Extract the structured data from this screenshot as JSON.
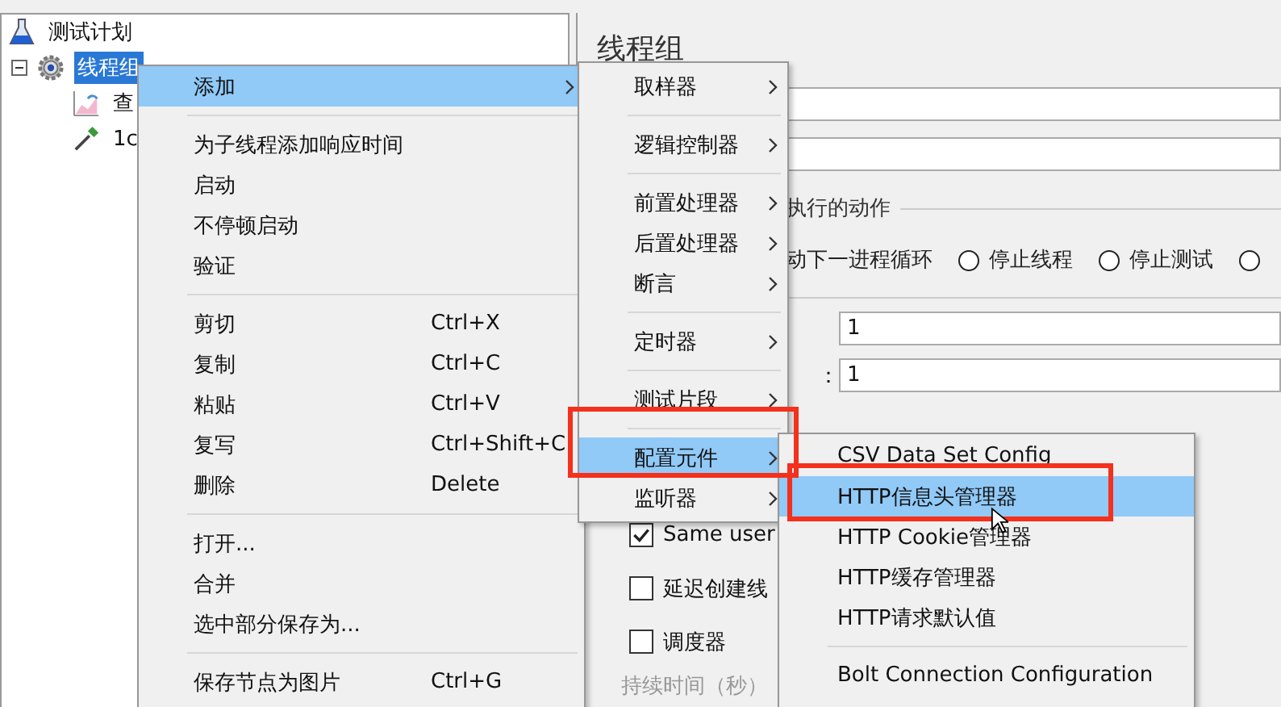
{
  "tree": [
    {
      "label": "测试计划",
      "selected": false,
      "children": [
        {
          "label": "线程组",
          "selected": true,
          "expanded": true,
          "children": [
            {
              "label": "查",
              "selected": false
            },
            {
              "label": "1c",
              "selected": false
            }
          ]
        }
      ]
    }
  ],
  "panel": {
    "title": "线程组",
    "action_group": {
      "legend": "执行的动作",
      "options": [
        {
          "kind": "text",
          "label": "动下一进程循环"
        },
        {
          "kind": "radio",
          "label": "停止线程",
          "selected": false
        },
        {
          "kind": "radio",
          "label": "停止测试",
          "selected": false
        },
        {
          "kind": "radio",
          "selected": false
        }
      ]
    },
    "counts": [
      {
        "value": "1"
      },
      {
        "label": "：",
        "value": "1"
      }
    ],
    "checkboxes": [
      {
        "label": "Same user",
        "checked": true
      },
      {
        "label": "延迟创建线",
        "checked": false
      },
      {
        "label": "调度器",
        "checked": false
      }
    ],
    "duration_label": "持续时间（秒）"
  },
  "context_menu": [
    {
      "kind": "item",
      "label": "添加",
      "submenu": true,
      "selected": true
    },
    {
      "kind": "separator"
    },
    {
      "kind": "item",
      "label": "为子线程添加响应时间",
      "submenu": false,
      "selected": false
    },
    {
      "kind": "item",
      "label": "启动",
      "submenu": false,
      "selected": false
    },
    {
      "kind": "item",
      "label": "不停顿启动",
      "submenu": false,
      "selected": false
    },
    {
      "kind": "item",
      "label": "验证",
      "submenu": false,
      "selected": false
    },
    {
      "kind": "separator"
    },
    {
      "kind": "item",
      "label": "剪切",
      "shortcut": "Ctrl+X",
      "submenu": false,
      "selected": false
    },
    {
      "kind": "item",
      "label": "复制",
      "shortcut": "Ctrl+C",
      "submenu": false,
      "selected": false
    },
    {
      "kind": "item",
      "label": "粘贴",
      "shortcut": "Ctrl+V",
      "submenu": false,
      "selected": false
    },
    {
      "kind": "item",
      "label": "复写",
      "shortcut": "Ctrl+Shift+C",
      "submenu": false,
      "selected": false
    },
    {
      "kind": "item",
      "label": "删除",
      "shortcut": "Delete",
      "submenu": false,
      "selected": false
    },
    {
      "kind": "separator"
    },
    {
      "kind": "item",
      "label": "打开...",
      "submenu": false,
      "selected": false
    },
    {
      "kind": "item",
      "label": "合并",
      "submenu": false,
      "selected": false
    },
    {
      "kind": "item",
      "label": "选中部分保存为...",
      "submenu": false,
      "selected": false
    },
    {
      "kind": "separator"
    },
    {
      "kind": "item",
      "label": "保存节点为图片",
      "shortcut": "Ctrl+G",
      "submenu": false,
      "selected": false
    }
  ],
  "add_submenu": [
    {
      "kind": "item",
      "label": "取样器",
      "submenu": true,
      "selected": false
    },
    {
      "kind": "separator"
    },
    {
      "kind": "item",
      "label": "逻辑控制器",
      "submenu": true,
      "selected": false
    },
    {
      "kind": "separator"
    },
    {
      "kind": "item",
      "label": "前置处理器",
      "submenu": true,
      "selected": false
    },
    {
      "kind": "item",
      "label": "后置处理器",
      "submenu": true,
      "selected": false
    },
    {
      "kind": "item",
      "label": "断言",
      "submenu": true,
      "selected": false
    },
    {
      "kind": "separator"
    },
    {
      "kind": "item",
      "label": "定时器",
      "submenu": true,
      "selected": false
    },
    {
      "kind": "separator"
    },
    {
      "kind": "item",
      "label": "测试片段",
      "submenu": true,
      "selected": false
    },
    {
      "kind": "separator"
    },
    {
      "kind": "item",
      "label": "配置元件",
      "submenu": true,
      "selected": true
    },
    {
      "kind": "item",
      "label": "监听器",
      "submenu": true,
      "selected": false
    }
  ],
  "config_submenu": [
    {
      "kind": "item",
      "label": "CSV Data Set Config",
      "submenu": false,
      "selected": false
    },
    {
      "kind": "item",
      "label": "HTTP信息头管理器",
      "submenu": false,
      "selected": true
    },
    {
      "kind": "item",
      "label": "HTTP Cookie管理器",
      "submenu": false,
      "selected": false
    },
    {
      "kind": "item",
      "label": "HTTP缓存管理器",
      "submenu": false,
      "selected": false
    },
    {
      "kind": "item",
      "label": "HTTP请求默认值",
      "submenu": false,
      "selected": false
    },
    {
      "kind": "separator"
    },
    {
      "kind": "item",
      "label": "Bolt Connection Configuration",
      "submenu": false,
      "selected": false
    }
  ]
}
